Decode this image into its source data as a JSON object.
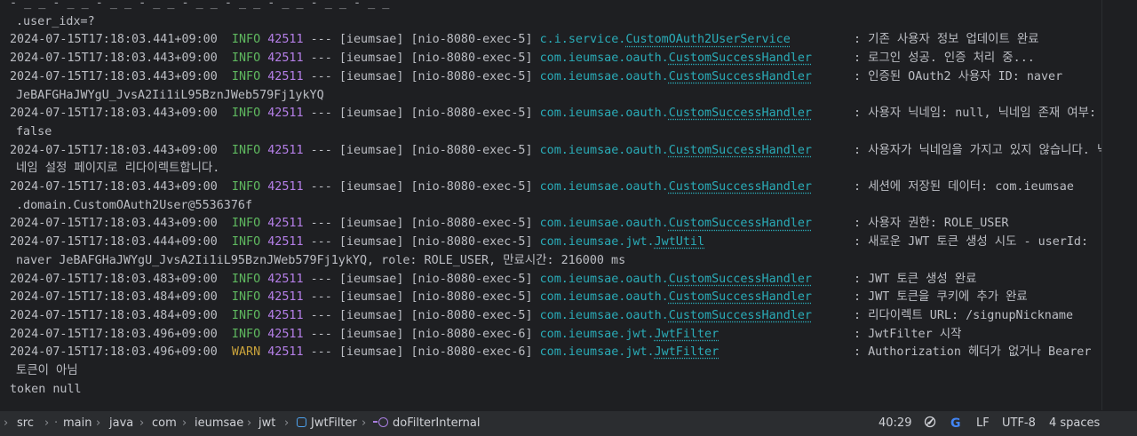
{
  "console": {
    "top_cut": "- _ _ - _ _ - _ _ - _ _ - _ _ - _ _ - _ _ - _ _ - _ _",
    "top_cont": ".user_idx=?",
    "entries": [
      {
        "ts": "2024-07-15T17:18:03.441+09:00",
        "level": "INFO",
        "pid": "42511",
        "sep": "---",
        "app": "[ieumsae]",
        "thread": "[nio-8080-exec-5]",
        "logger_pkg": "c.i.service.",
        "logger_cls": "CustomOAuth2UserService",
        "message": "기존 사용자 정보 업데이트 완료",
        "cont": ""
      },
      {
        "ts": "2024-07-15T17:18:03.443+09:00",
        "level": "INFO",
        "pid": "42511",
        "sep": "---",
        "app": "[ieumsae]",
        "thread": "[nio-8080-exec-5]",
        "logger_pkg": "com.ieumsae.oauth.",
        "logger_cls": "CustomSuccessHandler",
        "message": "로그인 성공. 인증 처리 중...",
        "cont": ""
      },
      {
        "ts": "2024-07-15T17:18:03.443+09:00",
        "level": "INFO",
        "pid": "42511",
        "sep": "---",
        "app": "[ieumsae]",
        "thread": "[nio-8080-exec-5]",
        "logger_pkg": "com.ieumsae.oauth.",
        "logger_cls": "CustomSuccessHandler",
        "message": "인증된 OAuth2 사용자 ID: naver",
        "cont": "JeBAFGHaJWYgU_JvsA2Ii1iL95BznJWeb579Fj1ykYQ"
      },
      {
        "ts": "2024-07-15T17:18:03.443+09:00",
        "level": "INFO",
        "pid": "42511",
        "sep": "---",
        "app": "[ieumsae]",
        "thread": "[nio-8080-exec-5]",
        "logger_pkg": "com.ieumsae.oauth.",
        "logger_cls": "CustomSuccessHandler",
        "message": "사용자 닉네임: null, 닉네임 존재 여부:",
        "cont": "false"
      },
      {
        "ts": "2024-07-15T17:18:03.443+09:00",
        "level": "INFO",
        "pid": "42511",
        "sep": "---",
        "app": "[ieumsae]",
        "thread": "[nio-8080-exec-5]",
        "logger_pkg": "com.ieumsae.oauth.",
        "logger_cls": "CustomSuccessHandler",
        "message": "사용자가 닉네임을 가지고 있지 않습니다. 닉",
        "cont": "네임 설정 페이지로 리다이렉트합니다."
      },
      {
        "ts": "2024-07-15T17:18:03.443+09:00",
        "level": "INFO",
        "pid": "42511",
        "sep": "---",
        "app": "[ieumsae]",
        "thread": "[nio-8080-exec-5]",
        "logger_pkg": "com.ieumsae.oauth.",
        "logger_cls": "CustomSuccessHandler",
        "message": "세션에 저장된 데이터: com.ieumsae",
        "cont": ".domain.CustomOAuth2User@5536376f"
      },
      {
        "ts": "2024-07-15T17:18:03.443+09:00",
        "level": "INFO",
        "pid": "42511",
        "sep": "---",
        "app": "[ieumsae]",
        "thread": "[nio-8080-exec-5]",
        "logger_pkg": "com.ieumsae.oauth.",
        "logger_cls": "CustomSuccessHandler",
        "message": "사용자 권한: ROLE_USER",
        "cont": ""
      },
      {
        "ts": "2024-07-15T17:18:03.444+09:00",
        "level": "INFO",
        "pid": "42511",
        "sep": "---",
        "app": "[ieumsae]",
        "thread": "[nio-8080-exec-5]",
        "logger_pkg": "com.ieumsae.jwt.",
        "logger_cls": "JwtUtil",
        "message": "새로운 JWT 토큰 생성 시도 - userId:",
        "cont": "naver JeBAFGHaJWYgU_JvsA2Ii1iL95BznJWeb579Fj1ykYQ, role: ROLE_USER, 만료시간: 216000 ms"
      },
      {
        "ts": "2024-07-15T17:18:03.483+09:00",
        "level": "INFO",
        "pid": "42511",
        "sep": "---",
        "app": "[ieumsae]",
        "thread": "[nio-8080-exec-5]",
        "logger_pkg": "com.ieumsae.oauth.",
        "logger_cls": "CustomSuccessHandler",
        "message": "JWT 토큰 생성 완료",
        "cont": ""
      },
      {
        "ts": "2024-07-15T17:18:03.484+09:00",
        "level": "INFO",
        "pid": "42511",
        "sep": "---",
        "app": "[ieumsae]",
        "thread": "[nio-8080-exec-5]",
        "logger_pkg": "com.ieumsae.oauth.",
        "logger_cls": "CustomSuccessHandler",
        "message": "JWT 토큰을 쿠키에 추가 완료",
        "cont": ""
      },
      {
        "ts": "2024-07-15T17:18:03.484+09:00",
        "level": "INFO",
        "pid": "42511",
        "sep": "---",
        "app": "[ieumsae]",
        "thread": "[nio-8080-exec-5]",
        "logger_pkg": "com.ieumsae.oauth.",
        "logger_cls": "CustomSuccessHandler",
        "message": "리다이렉트 URL: /signupNickname",
        "cont": ""
      },
      {
        "ts": "2024-07-15T17:18:03.496+09:00",
        "level": "INFO",
        "pid": "42511",
        "sep": "---",
        "app": "[ieumsae]",
        "thread": "[nio-8080-exec-6]",
        "logger_pkg": "com.ieumsae.jwt.",
        "logger_cls": "JwtFilter",
        "message": "JwtFilter 시작",
        "cont": ""
      },
      {
        "ts": "2024-07-15T17:18:03.496+09:00",
        "level": "WARN",
        "pid": "42511",
        "sep": "---",
        "app": "[ieumsae]",
        "thread": "[nio-8080-exec-6]",
        "logger_pkg": "com.ieumsae.jwt.",
        "logger_cls": "JwtFilter",
        "message": "Authorization 헤더가 없거나 Bearer",
        "cont": "토큰이 아님"
      }
    ],
    "trailing": "token null"
  },
  "status_bar": {
    "breadcrumbs": [
      "src",
      "main",
      "java",
      "com",
      "ieumsae",
      "jwt",
      "JwtFilter",
      "doFilterInternal"
    ],
    "position": "40:29",
    "line_ending": "LF",
    "encoding": "UTF-8",
    "indent": "4 spaces",
    "google_icon_label": "G"
  }
}
